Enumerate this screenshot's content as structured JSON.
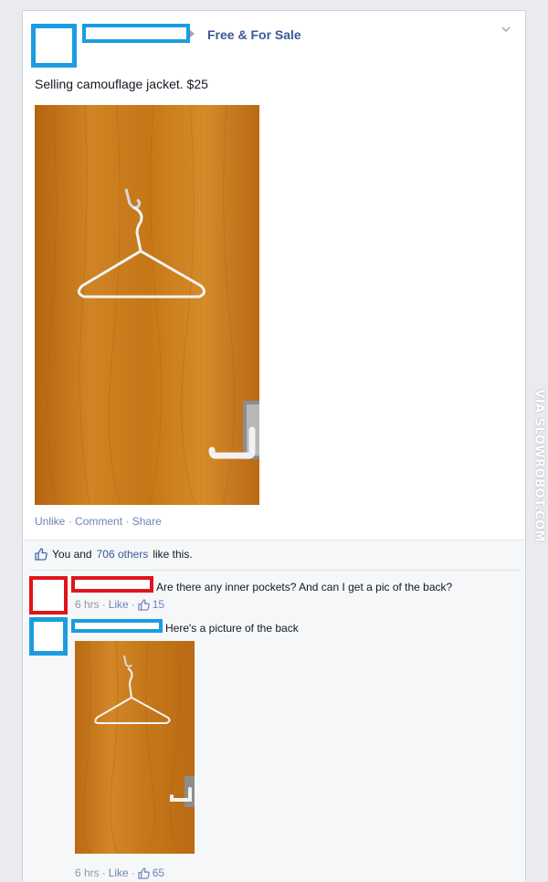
{
  "post": {
    "group_name": "Free & For Sale",
    "text": "Selling camouflage jacket. $25",
    "actions": {
      "unlike": "Unlike",
      "comment": "Comment",
      "share": "Share",
      "separator": "·"
    }
  },
  "likes": {
    "you_and": "You and",
    "others_link": "706 others",
    "suffix": "like this."
  },
  "comments": [
    {
      "text": "Are there any inner pockets? And can I get a pic of the back?",
      "time": "6 hrs",
      "like_label": "Like",
      "like_count": "15"
    },
    {
      "text": "Here's a picture of the back",
      "time": "6 hrs",
      "like_label": "Like",
      "like_count": "65"
    }
  ],
  "watermark": "VIA SLOWROBOT.COM",
  "icons": {
    "thumbs_up": "thumbs-up-icon",
    "chevron": "chevron-down-icon",
    "group_arrow": "triangle-right-icon"
  },
  "colors": {
    "link": "#3b5998",
    "muted_link": "#6d84b4",
    "muted_text": "#9197a3",
    "redact_blue": "#1a9de0",
    "redact_red": "#e0141a",
    "door_wood": "#c9781b"
  }
}
